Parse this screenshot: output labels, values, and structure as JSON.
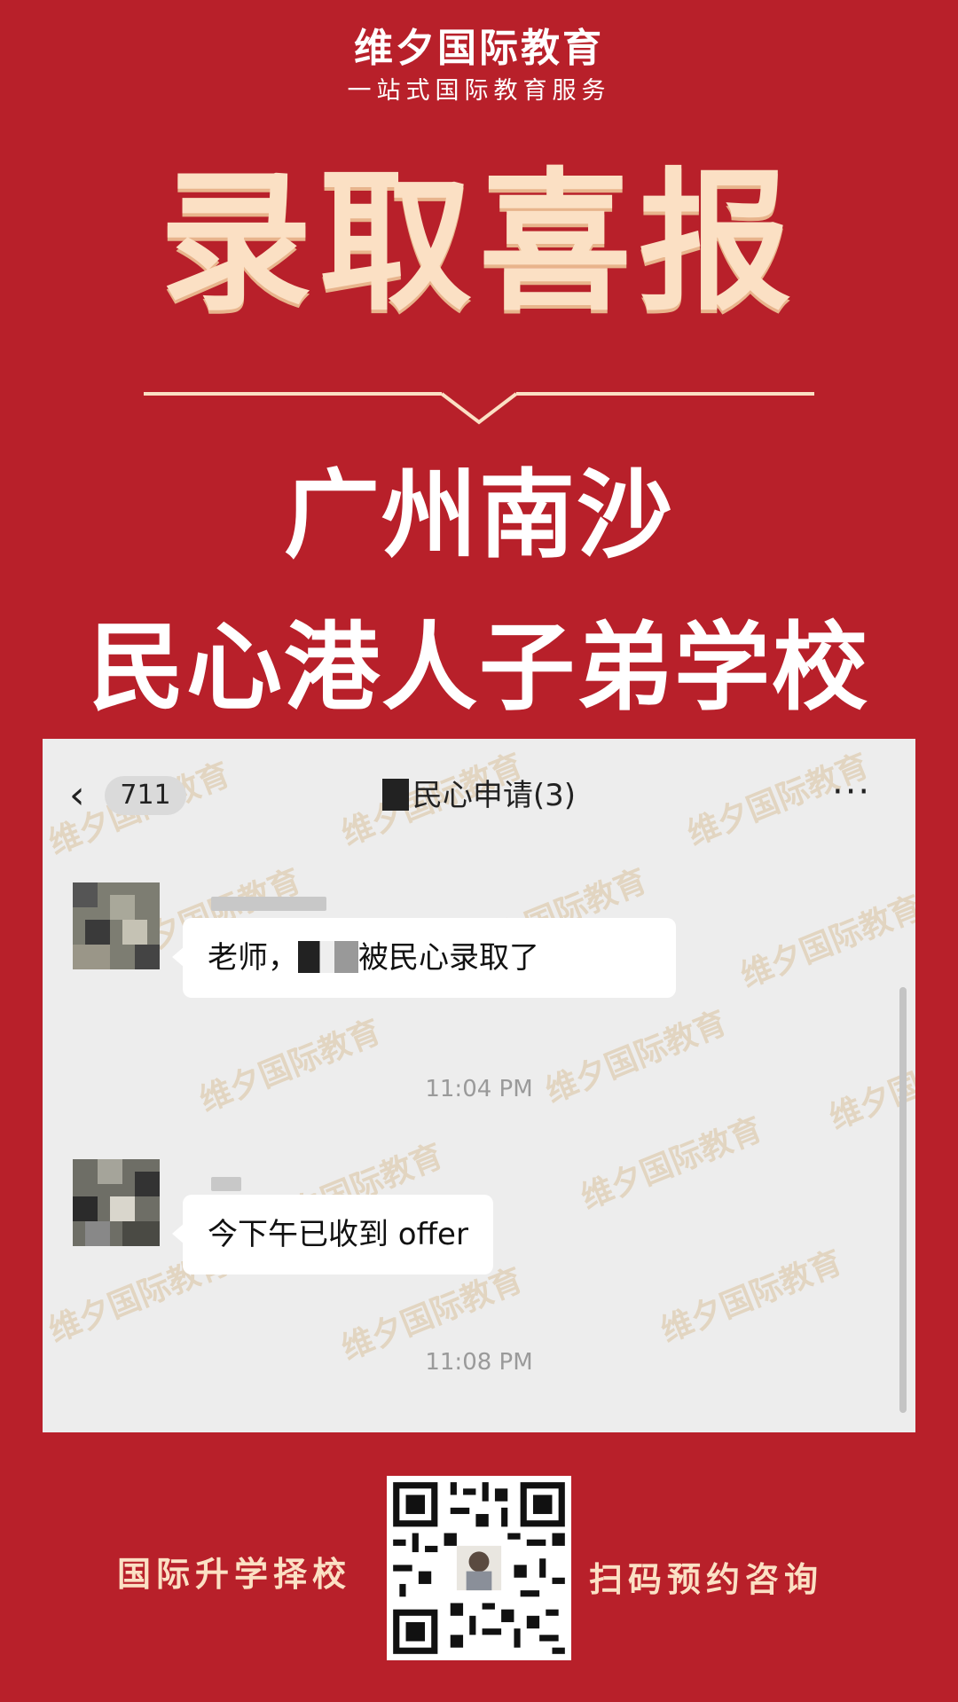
{
  "header": {
    "brand": "维夕国际教育",
    "tagline": "一站式国际教育服务"
  },
  "headline": "录取喜报",
  "school": {
    "line1": "广州南沙",
    "line2": "民心港人子弟学校"
  },
  "chat": {
    "unread_count": "711",
    "title": "民心申请(3)",
    "messages": [
      {
        "text_before": "老师，",
        "text_after": "被民心录取了",
        "timestamp": "11:04 PM"
      },
      {
        "text": "今下午已收到 offer",
        "timestamp": "11:08 PM"
      }
    ],
    "watermark": "维夕国际教育"
  },
  "footer": {
    "left_text": "国际升学择校",
    "right_text": "扫码预约咨询"
  },
  "colors": {
    "background": "#b8202a",
    "headline": "#fbe0c4",
    "chat_background": "#ededed"
  }
}
